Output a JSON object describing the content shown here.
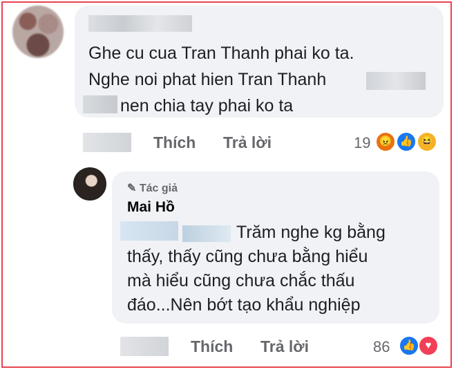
{
  "comment1": {
    "lines": [
      "Ghe cu cua Tran Thanh phai ko ta.",
      "Nghe noi phat hien Tran Thanh",
      "nen chia tay phai ko ta"
    ],
    "like_label": "Thích",
    "reply_label": "Trả lời",
    "reaction_count": "19",
    "reactions": [
      "angry-icon",
      "like-icon",
      "haha-icon"
    ]
  },
  "comment2": {
    "author_badge": "Tác giả",
    "author_name": "Mai Hồ",
    "lines": [
      "Trăm nghe kg bằng",
      "thấy, thấy cũng chưa bằng hiểu",
      "mà hiểu cũng chưa chắc thấu",
      "đáo...Nên bớt tạo khẩu nghiệp"
    ],
    "like_label": "Thích",
    "reply_label": "Trả lời",
    "reaction_count": "86",
    "reactions": [
      "like-icon",
      "love-icon"
    ]
  },
  "colors": {
    "frame": "#e8434f",
    "bubble": "#f0f2f5",
    "like": "#1877f2",
    "love": "#f33e58",
    "haha": "#f7b125"
  }
}
